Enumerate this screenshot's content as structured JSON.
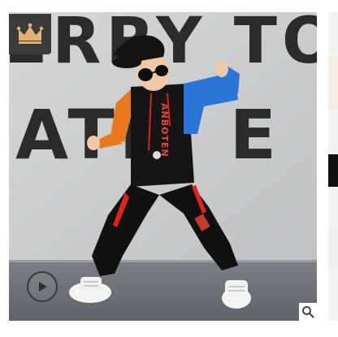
{
  "image": {
    "wall_text_line1": "ERRY TO",
    "wall_text_line2": "ATIE E",
    "shirt_print": "ANBOTEN"
  },
  "controls": {
    "badge_icon": "crown-icon",
    "play_icon": "play-icon",
    "zoom_icon": "magnifier-icon"
  },
  "colors": {
    "badge_bg": "#3a3a3a",
    "badge_crown": "#e6b070",
    "shirt_blue": "#2a76d6",
    "shirt_orange": "#e8781e",
    "pants_stripe": "#e2231a"
  }
}
